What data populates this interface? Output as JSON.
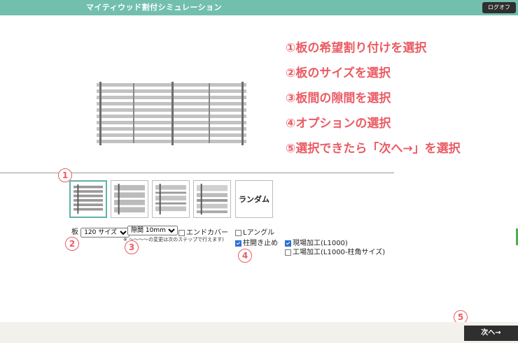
{
  "header": {
    "title": "マイティウッド割付シミュレーション",
    "logout_label": "ログオフ"
  },
  "steps": [
    "①板の希望割り付けを選択",
    "②板のサイズを選択",
    "③板間の隙間を選択",
    "④オプションの選択",
    "⑤選択できたら「次へ→」を選択"
  ],
  "markers": {
    "m1": "1",
    "m2": "2",
    "m3": "3",
    "m4": "4",
    "m5": "5"
  },
  "patterns": {
    "random_label": "ランダム",
    "selected_index": 0
  },
  "controls": {
    "board_label": "板",
    "board_size": {
      "selected": "120 サイズ",
      "options": [
        "120 サイズ"
      ]
    },
    "gap": {
      "selected": "隙間 10mm",
      "options": [
        "隙間 10mm"
      ]
    },
    "end_cover": {
      "label": "エンドカバー",
      "checked": false
    },
    "l_angle": {
      "label": "Lアングル",
      "checked": false
    },
    "post_cap": {
      "label": "柱開き止め",
      "checked": true
    },
    "site_processing": {
      "label": "現場加工(L1000)",
      "checked": true
    },
    "factory_processing": {
      "label": "工場加工(L1000-柱角サイズ)",
      "checked": false
    },
    "note": "※ 〜〜〜〜の変更は次のステップで行えます)"
  },
  "footer": {
    "next_label": "次へ→"
  },
  "colors": {
    "header": "#72bfae",
    "accent": "#ea5c64",
    "dark": "#2f2f2f"
  }
}
